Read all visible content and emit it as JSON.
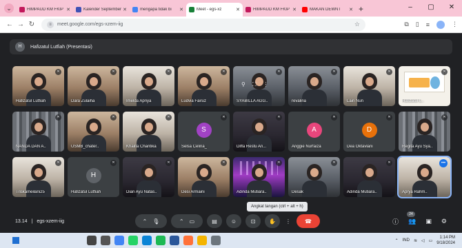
{
  "browser": {
    "tabs": [
      {
        "label": "HIMPAUD KM FKIP",
        "color": "#c2185b",
        "active": false
      },
      {
        "label": "Kalender September",
        "color": "#3f51b5",
        "active": false
      },
      {
        "label": "mengapa tidak bi",
        "color": "#4285f4",
        "active": false
      },
      {
        "label": "Meet - egs-xz",
        "color": "#188038",
        "active": true
      },
      {
        "label": "HIMPAUD KM FKIP",
        "color": "#c2185b",
        "active": false
      },
      {
        "label": "MAKAN DEWNT",
        "color": "#ff0000",
        "active": false
      }
    ],
    "new_tab_label": "+",
    "window_controls": [
      "–",
      "▢",
      "✕"
    ],
    "url": "meet.google.com/egs-xzem-iig"
  },
  "presenter": {
    "initial": "H",
    "title": "Hafizatul Lutfiah (Presentasi)"
  },
  "participants": [
    {
      "name": "Hafizatul Lutfiah",
      "style": "photo warm"
    },
    {
      "name": "Dara Zulaiha",
      "style": "photo warm"
    },
    {
      "name": "Imelda Apriya",
      "style": "photo light"
    },
    {
      "name": "Ludvia Fairuz",
      "style": "photo warm"
    },
    {
      "name": "SYABILLA AGG..",
      "style": "photo"
    },
    {
      "name": "revalina",
      "style": "photo"
    },
    {
      "name": "Lain Nun",
      "style": "photo light"
    },
    {
      "name": "Hafizatul L..",
      "style": "photo slide"
    },
    {
      "name": "NANDA DAN A..",
      "style": "photo shelf"
    },
    {
      "name": "USMB_chater..",
      "style": "photo warm"
    },
    {
      "name": "Khalifa Chantika",
      "style": "photo light"
    },
    {
      "name": "Selsa Celina_",
      "letter": "S",
      "letter_color": "#a142c4"
    },
    {
      "name": "Diffa Restu An...",
      "style": "photo dark"
    },
    {
      "name": "Anggie Nurfaiza",
      "letter": "A",
      "letter_color": "#e8467c"
    },
    {
      "name": "Dea Oktavlani",
      "letter": "D",
      "letter_color": "#e8710a"
    },
    {
      "name": "Regita Ayu Sya..",
      "style": "photo shelf"
    },
    {
      "name": "Triskameilani25",
      "style": "photo light"
    },
    {
      "name": "Hafizatul Lutfiah",
      "letter": "H",
      "letter_color": "#5f6368"
    },
    {
      "name": "Dian Ayu Natas..",
      "style": "photo dark"
    },
    {
      "name": "Desi Armaini",
      "style": "photo warm"
    },
    {
      "name": "Adinda Mutiara..",
      "style": "photo neon"
    },
    {
      "name": "Desak",
      "style": "photo"
    },
    {
      "name": "Adinda Mutiara..",
      "style": "photo dark"
    },
    {
      "name": "Aprya Rahm..",
      "style": "photo light",
      "selected": true
    }
  ],
  "tooltip": "Angkat tangan (ctrl + alt + h)",
  "meeting": {
    "time": "13.14",
    "code": "egs-xzem-iig",
    "people_count": "24"
  },
  "taskbar": {
    "language": "IND",
    "time": "1:14 PM",
    "date": "9/18/2024",
    "icons": [
      {
        "name": "search-taskbar-icon",
        "color": "#444"
      },
      {
        "name": "task-view-icon",
        "color": "#555"
      },
      {
        "name": "chrome-icon",
        "color": "#4285f4"
      },
      {
        "name": "whatsapp-icon",
        "color": "#25d366"
      },
      {
        "name": "edge-icon",
        "color": "#0a84d6"
      },
      {
        "name": "spotify-icon",
        "color": "#1db954"
      },
      {
        "name": "word-icon",
        "color": "#2b579a"
      },
      {
        "name": "firefox-icon",
        "color": "#ff7139"
      },
      {
        "name": "files-icon",
        "color": "#f4b400"
      },
      {
        "name": "settings-icon",
        "color": "#6c757d"
      }
    ]
  }
}
